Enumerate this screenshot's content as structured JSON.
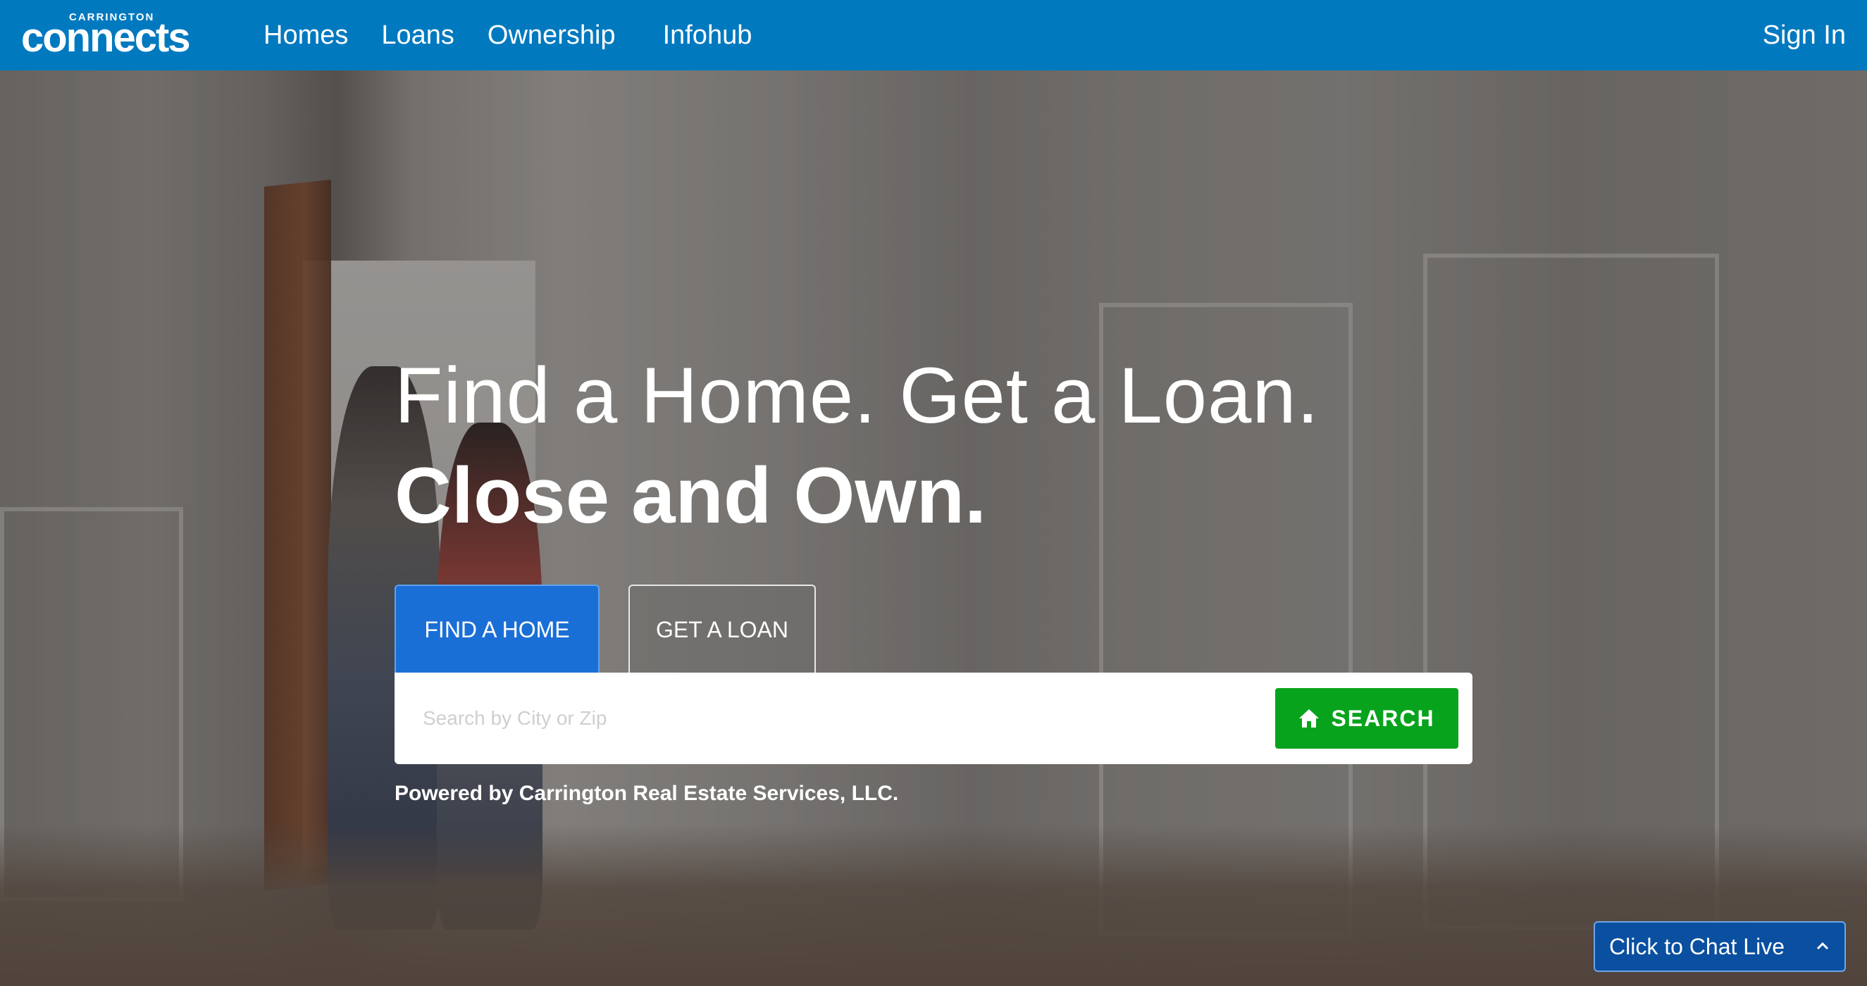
{
  "header": {
    "logo_small": "CARRINGTON",
    "logo_main": "connects",
    "nav": [
      "Homes",
      "Loans",
      "Ownership",
      "Infohub"
    ],
    "sign_in": "Sign In"
  },
  "hero": {
    "headline_line1": "Find a Home. Get a Loan.",
    "headline_line2": "Close and Own.",
    "tabs": [
      "FIND A HOME",
      "GET A LOAN"
    ],
    "active_tab": "FIND A HOME",
    "search": {
      "placeholder": "Search by City or Zip",
      "value": "",
      "button_label": "SEARCH"
    },
    "powered_by": "Powered by Carrington Real Estate Services, LLC."
  },
  "chat": {
    "label": "Click to Chat Live"
  },
  "colors": {
    "header_bg": "#0079bf",
    "active_tab": "#1a6fd6",
    "search_button": "#08a31c",
    "chat_bg": "#0a4fa0"
  },
  "icons": [
    "home-icon",
    "chevron-up-icon"
  ]
}
